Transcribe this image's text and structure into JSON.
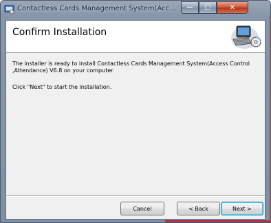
{
  "window": {
    "title": "Contactless Cards Management System(Access Control & Attendanc...",
    "minimize_glyph": "—",
    "maximize_glyph": "☐",
    "close_glyph": "✕"
  },
  "banner": {
    "title": "Confirm Installation",
    "graphic_icon": "computer-with-cd-icon"
  },
  "body": {
    "line1": "The installer is ready to install Contactless Cards Management System(Access Control ,Attendance) V6.8 on your computer.",
    "line2": "Click \"Next\" to start the installation."
  },
  "buttons": {
    "cancel": "Cancel",
    "back": "< Back",
    "next": "Next >"
  },
  "colors": {
    "titlebar": "#8796aa",
    "close_button": "#c85439",
    "default_button_border": "#3c7fb1"
  }
}
